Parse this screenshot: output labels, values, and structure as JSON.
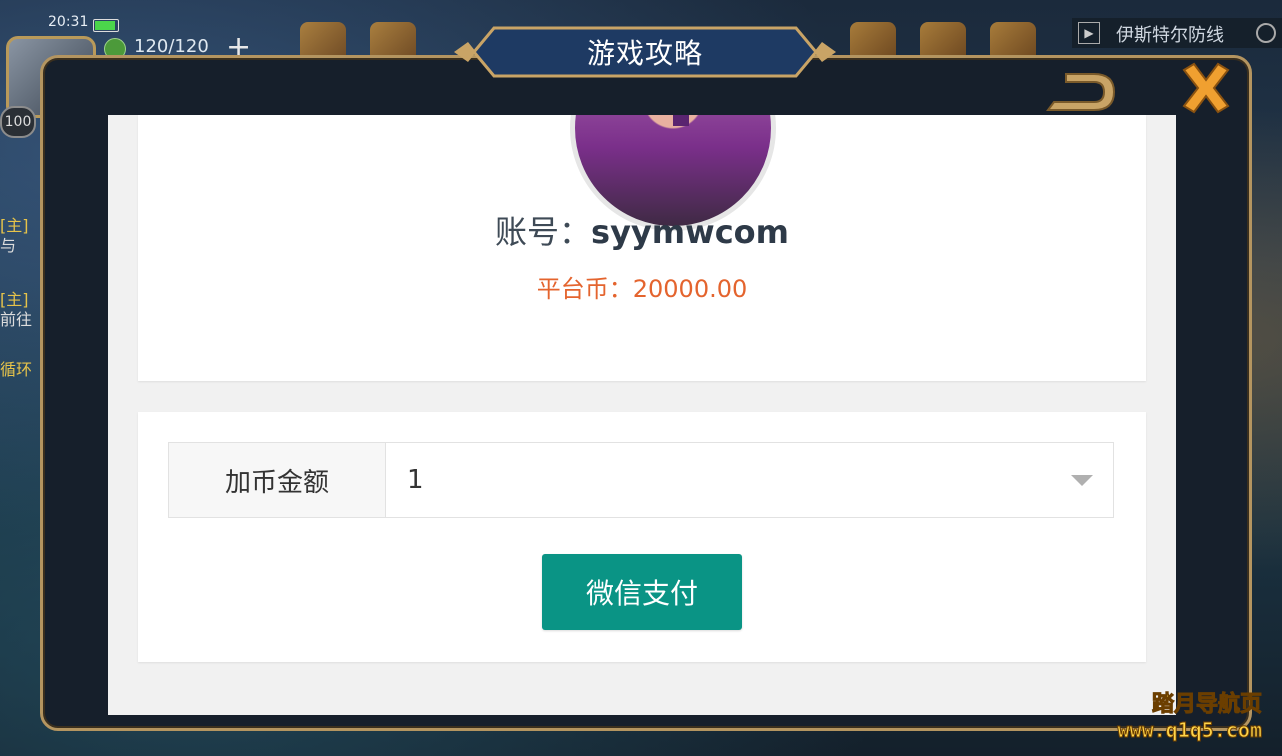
{
  "status": {
    "time": "20:31",
    "stamina": "120/120",
    "level": "100"
  },
  "top_bar": {
    "location": "伊斯特尔防线"
  },
  "quests": [
    {
      "tag": "[主]",
      "text": "与"
    },
    {
      "tag": "[主]",
      "text": "前往"
    },
    {
      "tag": "循环",
      "text": ""
    }
  ],
  "dialog": {
    "title": "游戏攻略"
  },
  "profile": {
    "account_label": "账号：",
    "account_value": "syymwcom",
    "balance_label": "平台币：",
    "balance_value": "20000.00"
  },
  "payment": {
    "amount_label": "加币金额",
    "amount_value": "1",
    "pay_button_label": "微信支付"
  },
  "watermark": {
    "line1": "踏月导航页",
    "line2": "www.q1q5.com"
  },
  "colors": {
    "balance": "#e4642e",
    "pay_button": "#0a9485",
    "frame_gold": "#b49560"
  }
}
